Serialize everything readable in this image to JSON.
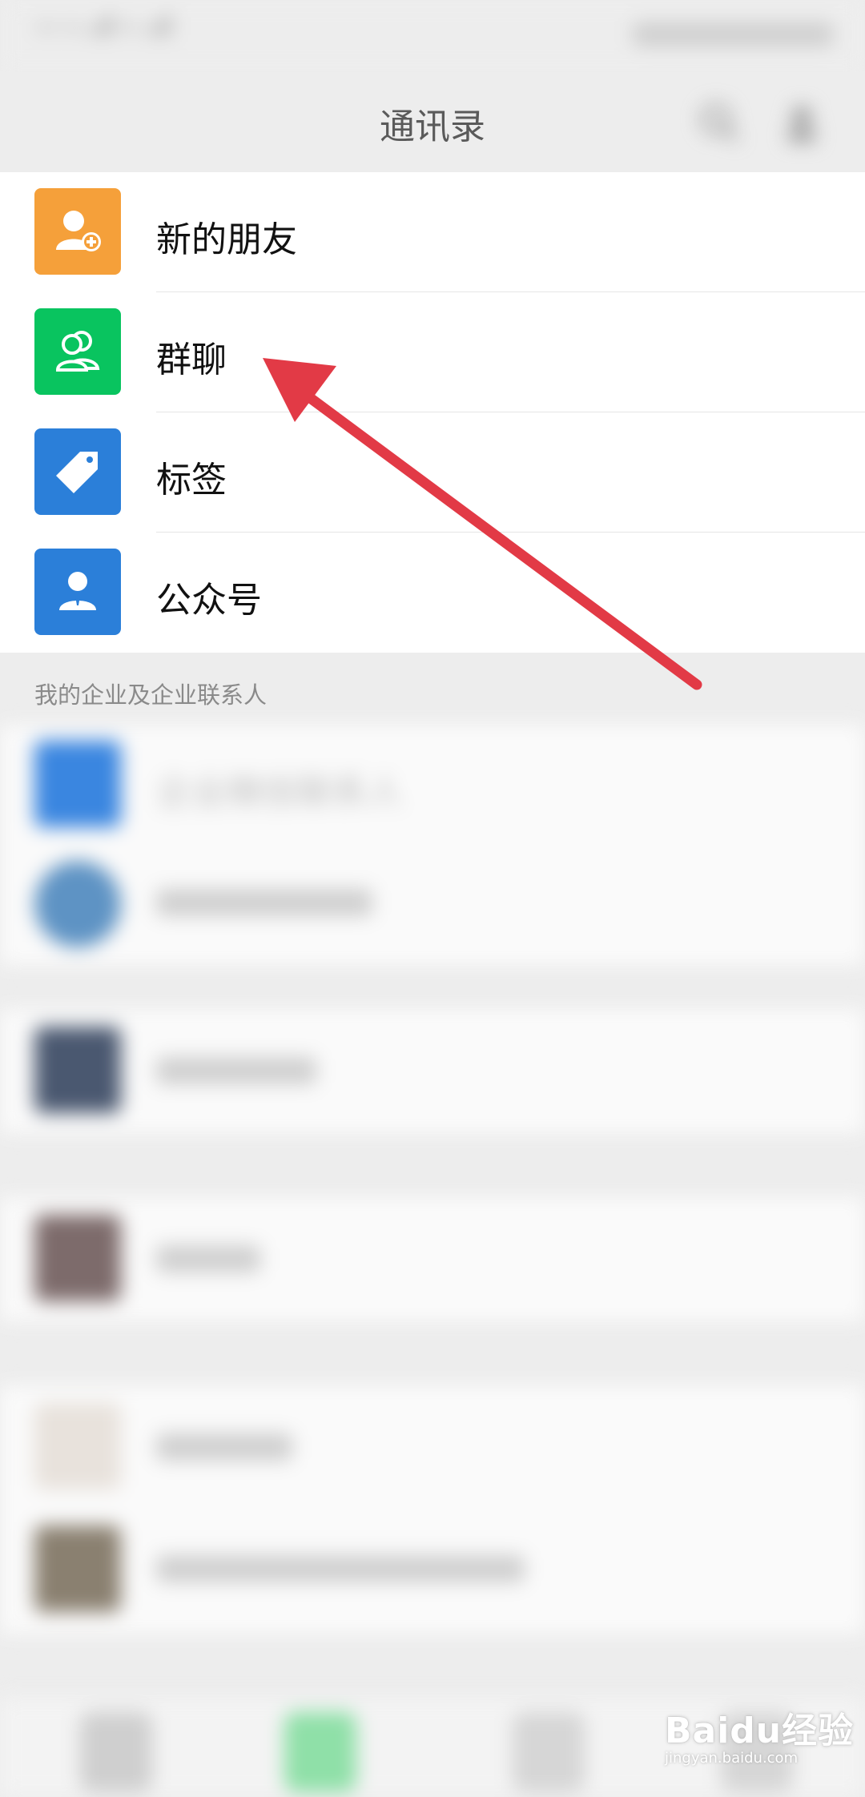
{
  "status_bar": {
    "network_1": "4G",
    "network_2": "4G",
    "hd_badge": "HD"
  },
  "header": {
    "title": "通讯录"
  },
  "contacts_menu": [
    {
      "label": "新的朋友",
      "icon": "add-friend-icon",
      "color": "#f5a03a"
    },
    {
      "label": "群聊",
      "icon": "group-chat-icon",
      "color": "#09c45f"
    },
    {
      "label": "标签",
      "icon": "tag-icon",
      "color": "#2b7fd9"
    },
    {
      "label": "公众号",
      "icon": "official-account-icon",
      "color": "#2b7fd9"
    }
  ],
  "section": {
    "enterprise_label": "我的企业及企业联系人"
  },
  "enterprise": {
    "wework_label": "企业微信联系人"
  },
  "annotation": {
    "arrow_color": "#e23a46"
  },
  "watermark": {
    "brand": "Baidu经验",
    "url": "jingyan.baidu.com"
  }
}
